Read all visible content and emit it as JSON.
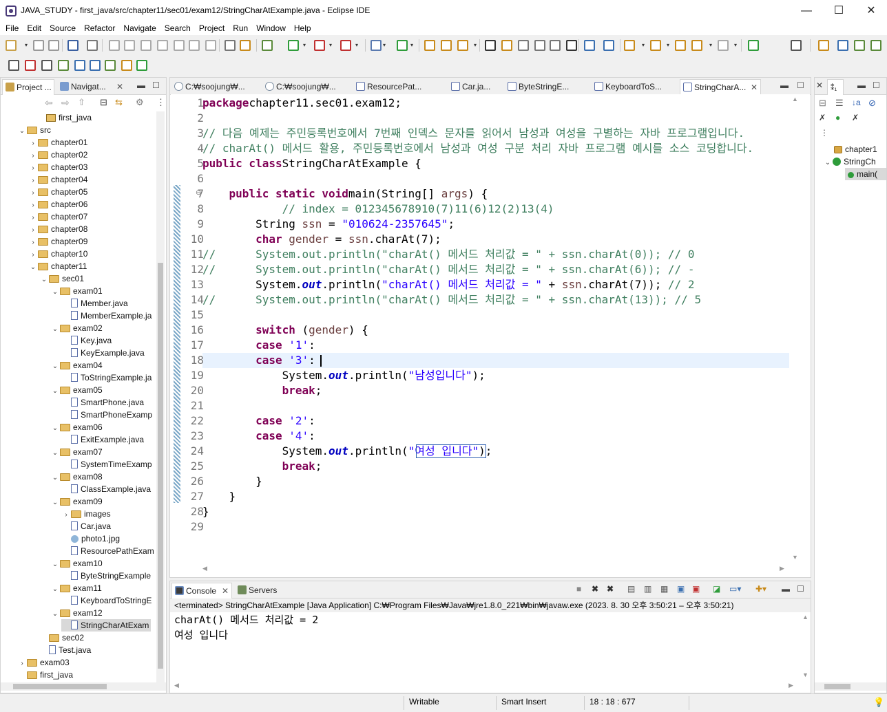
{
  "window": {
    "title": "JAVA_STUDY - first_java/src/chapter11/sec01/exam12/StringCharAtExample.java - Eclipse IDE",
    "minimize": "—",
    "maximize": "☐",
    "close": "✕"
  },
  "menu": [
    "File",
    "Edit",
    "Source",
    "Refactor",
    "Navigate",
    "Search",
    "Project",
    "Run",
    "Window",
    "Help"
  ],
  "left_panel": {
    "tabs": [
      "Project ...",
      "Navigat..."
    ],
    "tree": [
      {
        "label": "first_java",
        "indent": 0,
        "type": "proj",
        "arrow": ""
      },
      {
        "label": "src",
        "indent": 1,
        "type": "folder",
        "arrow": "⌄"
      },
      {
        "label": "chapter01",
        "indent": 2,
        "type": "folder",
        "arrow": "›"
      },
      {
        "label": "chapter02",
        "indent": 2,
        "type": "folder",
        "arrow": "›"
      },
      {
        "label": "chapter03",
        "indent": 2,
        "type": "folder",
        "arrow": "›"
      },
      {
        "label": "chapter04",
        "indent": 2,
        "type": "folder",
        "arrow": "›"
      },
      {
        "label": "chapter05",
        "indent": 2,
        "type": "folder",
        "arrow": "›"
      },
      {
        "label": "chapter06",
        "indent": 2,
        "type": "folder",
        "arrow": "›"
      },
      {
        "label": "chapter07",
        "indent": 2,
        "type": "folder",
        "arrow": "›"
      },
      {
        "label": "chapter08",
        "indent": 2,
        "type": "folder",
        "arrow": "›"
      },
      {
        "label": "chapter09",
        "indent": 2,
        "type": "folder",
        "arrow": "›"
      },
      {
        "label": "chapter10",
        "indent": 2,
        "type": "folder",
        "arrow": "›"
      },
      {
        "label": "chapter11",
        "indent": 2,
        "type": "folder",
        "arrow": "⌄"
      },
      {
        "label": "sec01",
        "indent": 3,
        "type": "folder",
        "arrow": "⌄"
      },
      {
        "label": "exam01",
        "indent": 4,
        "type": "folder",
        "arrow": "⌄"
      },
      {
        "label": "Member.java",
        "indent": 5,
        "type": "java",
        "arrow": ""
      },
      {
        "label": "MemberExample.ja",
        "indent": 5,
        "type": "java",
        "arrow": ""
      },
      {
        "label": "exam02",
        "indent": 4,
        "type": "folder",
        "arrow": "⌄"
      },
      {
        "label": "Key.java",
        "indent": 5,
        "type": "java",
        "arrow": ""
      },
      {
        "label": "KeyExample.java",
        "indent": 5,
        "type": "java",
        "arrow": ""
      },
      {
        "label": "exam04",
        "indent": 4,
        "type": "folder",
        "arrow": "⌄"
      },
      {
        "label": "ToStringExample.ja",
        "indent": 5,
        "type": "java",
        "arrow": ""
      },
      {
        "label": "exam05",
        "indent": 4,
        "type": "folder",
        "arrow": "⌄"
      },
      {
        "label": "SmartPhone.java",
        "indent": 5,
        "type": "java",
        "arrow": ""
      },
      {
        "label": "SmartPhoneExamp",
        "indent": 5,
        "type": "java",
        "arrow": ""
      },
      {
        "label": "exam06",
        "indent": 4,
        "type": "folder",
        "arrow": "⌄"
      },
      {
        "label": "ExitExample.java",
        "indent": 5,
        "type": "java",
        "arrow": ""
      },
      {
        "label": "exam07",
        "indent": 4,
        "type": "folder",
        "arrow": "⌄"
      },
      {
        "label": "SystemTimeExamp",
        "indent": 5,
        "type": "java",
        "arrow": ""
      },
      {
        "label": "exam08",
        "indent": 4,
        "type": "folder",
        "arrow": "⌄"
      },
      {
        "label": "ClassExample.java",
        "indent": 5,
        "type": "java",
        "arrow": ""
      },
      {
        "label": "exam09",
        "indent": 4,
        "type": "folder",
        "arrow": "⌄"
      },
      {
        "label": "images",
        "indent": 5,
        "type": "folder",
        "arrow": "›"
      },
      {
        "label": "Car.java",
        "indent": 5,
        "type": "java",
        "arrow": ""
      },
      {
        "label": "photo1.jpg",
        "indent": 5,
        "type": "jpg",
        "arrow": ""
      },
      {
        "label": "ResourcePathExam",
        "indent": 5,
        "type": "java",
        "arrow": ""
      },
      {
        "label": "exam10",
        "indent": 4,
        "type": "folder",
        "arrow": "⌄"
      },
      {
        "label": "ByteStringExample",
        "indent": 5,
        "type": "java",
        "arrow": ""
      },
      {
        "label": "exam11",
        "indent": 4,
        "type": "folder",
        "arrow": "⌄"
      },
      {
        "label": "KeyboardToStringE",
        "indent": 5,
        "type": "java",
        "arrow": ""
      },
      {
        "label": "exam12",
        "indent": 4,
        "type": "folder",
        "arrow": "⌄"
      },
      {
        "label": "StringCharAtExam",
        "indent": 5,
        "type": "java",
        "arrow": "",
        "selected": true
      },
      {
        "label": "sec02",
        "indent": 3,
        "type": "folder",
        "arrow": ""
      },
      {
        "label": "Test.java",
        "indent": 3,
        "type": "java",
        "arrow": ""
      },
      {
        "label": "exam03",
        "indent": 1,
        "type": "folder",
        "arrow": "›"
      },
      {
        "label": "first_java",
        "indent": 1,
        "type": "folder",
        "arrow": ""
      }
    ]
  },
  "editor": {
    "tabs": [
      "C:₩soojung₩...",
      "C:₩soojung₩...",
      "ResourcePat...",
      "Car.ja...",
      "ByteStringE...",
      "KeyboardToS...",
      "StringCharA..."
    ],
    "line_numbers": [
      "1",
      "2",
      "3",
      "4",
      "5",
      "6",
      "7",
      "8",
      "9",
      "10",
      "11",
      "12",
      "13",
      "14",
      "15",
      "16",
      "17",
      "18",
      "19",
      "20",
      "21",
      "22",
      "23",
      "24",
      "25",
      "26",
      "27",
      "28",
      "29"
    ],
    "lines": [
      [
        [
          "kw",
          "package"
        ],
        [
          "",
          "chapter11.sec01.exam12;"
        ]
      ],
      [],
      [
        [
          "cm",
          "// 다음 예제는 주민등록번호에서 7번째 인덱스 문자를 읽어서 남성과 여성을 구별하는 자바 프로그램입니다."
        ]
      ],
      [
        [
          "cm",
          "// charAt() 메서드 활용, 주민등록번호에서 남성과 여성 구분 처리 자바 프로그램 예시를 소스 코딩합니다."
        ]
      ],
      [
        [
          "kw",
          "public class"
        ],
        [
          "",
          "StringCharAtExample {"
        ]
      ],
      [],
      [
        [
          "",
          "    "
        ],
        [
          "kw",
          "public static void"
        ],
        [
          "",
          "main(String[] "
        ],
        [
          "var",
          "args"
        ],
        [
          "",
          ") {"
        ]
      ],
      [
        [
          "",
          "            "
        ],
        [
          "cm",
          "// index = 012345678910(7)11(6)12(2)13(4)"
        ]
      ],
      [
        [
          "",
          "        String "
        ],
        [
          "var",
          "ssn"
        ],
        [
          "",
          " = "
        ],
        [
          "str",
          "\"010624-2357645\""
        ],
        [
          "",
          ";"
        ]
      ],
      [
        [
          "",
          "        "
        ],
        [
          "kw",
          "char"
        ],
        [
          "var",
          " gender"
        ],
        [
          "",
          " = "
        ],
        [
          "var",
          "ssn"
        ],
        [
          "",
          ".charAt(7);"
        ]
      ],
      [
        [
          "cm",
          "//      System.out.println(\"charAt() 메서드 처리값 = \" + ssn.charAt(0)); // 0"
        ]
      ],
      [
        [
          "cm",
          "//      System.out.println(\"charAt() 메서드 처리값 = \" + ssn.charAt(6)); // -"
        ]
      ],
      [
        [
          "",
          "        System."
        ],
        [
          "fld",
          "out"
        ],
        [
          "",
          ".println("
        ],
        [
          "str",
          "\"charAt() 메서드 처리값 = \""
        ],
        [
          "",
          " + "
        ],
        [
          "var",
          "ssn"
        ],
        [
          "",
          ".charAt(7)); "
        ],
        [
          "cm",
          "// 2"
        ]
      ],
      [
        [
          "cm",
          "//      System.out.println(\"charAt() 메서드 처리값 = \" + ssn.charAt(13)); // 5"
        ]
      ],
      [],
      [
        [
          "",
          "        "
        ],
        [
          "kw",
          "switch"
        ],
        [
          "",
          " ("
        ],
        [
          "var",
          "gender"
        ],
        [
          "",
          ") {"
        ]
      ],
      [
        [
          "",
          "        "
        ],
        [
          "kw",
          "case"
        ],
        [
          "",
          ""
        ],
        [
          "str",
          " '1'"
        ],
        [
          "",
          ":"
        ]
      ],
      [
        [
          "",
          "        "
        ],
        [
          "kw",
          "case"
        ],
        [
          "str",
          " '3'"
        ],
        [
          "",
          ":"
        ]
      ],
      [
        [
          "",
          "            System."
        ],
        [
          "fld",
          "out"
        ],
        [
          "",
          ".println("
        ],
        [
          "str",
          "\"남성입니다\""
        ],
        [
          "",
          ");"
        ]
      ],
      [
        [
          "",
          "            "
        ],
        [
          "kw",
          "break"
        ],
        [
          "",
          ";"
        ]
      ],
      [],
      [
        [
          "",
          "        "
        ],
        [
          "kw",
          "case"
        ],
        [
          "str",
          " '2'"
        ],
        [
          "",
          ":"
        ]
      ],
      [
        [
          "",
          "        "
        ],
        [
          "kw",
          "case"
        ],
        [
          "str",
          " '4'"
        ],
        [
          "",
          ":"
        ]
      ],
      [
        [
          "",
          "            System."
        ],
        [
          "fld",
          "out"
        ],
        [
          "",
          ".println("
        ],
        [
          "str",
          "\"여성 입니다\""
        ],
        [
          "",
          ");"
        ]
      ],
      [
        [
          "",
          "            "
        ],
        [
          "kw",
          "break"
        ],
        [
          "",
          ";"
        ]
      ],
      [
        [
          "",
          "        }"
        ]
      ],
      [
        [
          "",
          "    }"
        ]
      ],
      [
        [
          "",
          "}"
        ]
      ],
      []
    ],
    "current_line": 18
  },
  "outline": {
    "items": [
      "chapter1",
      "StringCh",
      "main("
    ]
  },
  "console": {
    "tabs": [
      "Console",
      "Servers"
    ],
    "header": "<terminated> StringCharAtExample [Java Application] C:₩Program Files₩Java₩jre1.8.0_221₩bin₩javaw.exe  (2023. 8. 30 오후 3:50:21 – 오후 3:50:21)",
    "output": [
      "charAt() 메서드 처리값 = 2",
      "여성 입니다"
    ]
  },
  "status": {
    "mode": "Writable",
    "insert": "Smart Insert",
    "position": "18 : 18 : 677"
  },
  "colors": {
    "keyword": "#7f0055",
    "string": "#2a00ff",
    "comment": "#3f7f5f",
    "current_line": "#e8f2fe"
  }
}
